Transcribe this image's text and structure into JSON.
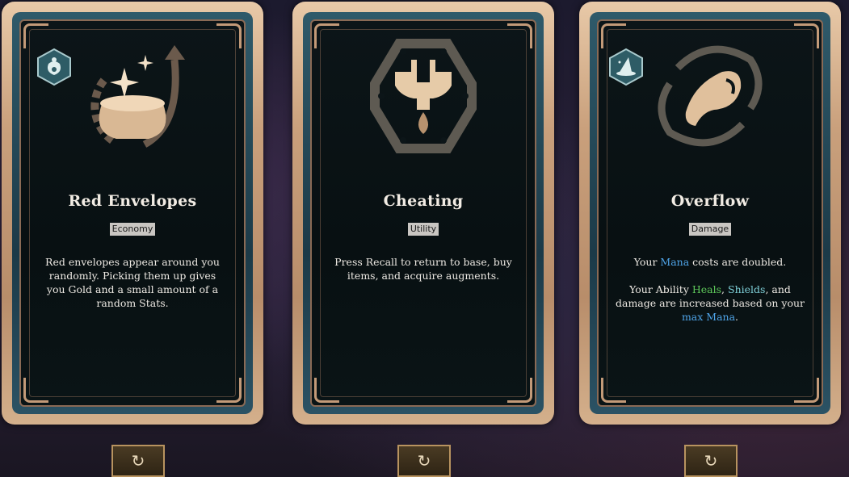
{
  "cards": [
    {
      "title": "Red Envelopes",
      "tag": "Economy",
      "description": "Red envelopes appear around you randomly. Picking them up gives you Gold and a small amount of a random Stats.",
      "badge_icon": "money-bag-icon",
      "art_icon": "gold-pot-reroll-icon"
    },
    {
      "title": "Cheating",
      "tag": "Utility",
      "description": "Press Recall to return to base, buy items, and acquire augments.",
      "art_icon": "wrench-hexagon-icon"
    },
    {
      "title": "Overflow",
      "tag": "Damage",
      "badge_icon": "wizard-hat-icon",
      "art_icon": "mana-swirl-icon",
      "desc_line1": {
        "a": "Your ",
        "mana": "Mana",
        "b": " costs are doubled."
      },
      "desc_line2": {
        "a": "Your Ability ",
        "heals": "Heals",
        "comma": ", ",
        "shields": "Shields",
        "b": ", and damage are increased based on your ",
        "max_mana": "max Mana",
        "end": "."
      }
    }
  ],
  "reroll_buttons": [
    {
      "icon": "reroll-icon",
      "glyph": "↻"
    },
    {
      "icon": "reroll-icon",
      "glyph": "↻"
    },
    {
      "icon": "reroll-icon",
      "glyph": "↻"
    }
  ],
  "colors": {
    "mana": "#4fa4e8",
    "heal": "#5ec85a",
    "shield": "#7fd0d8",
    "card_border": "#c9a07c"
  }
}
